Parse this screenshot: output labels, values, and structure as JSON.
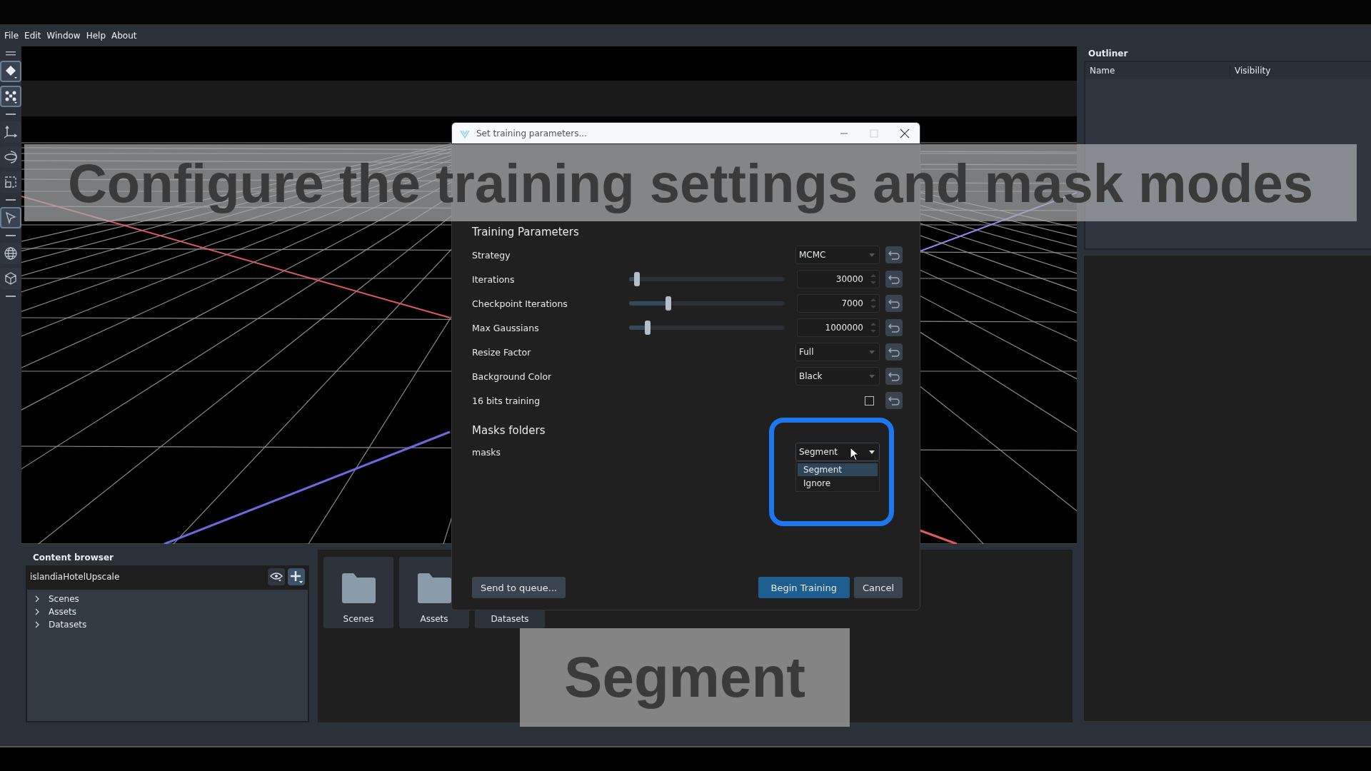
{
  "menu": [
    "File",
    "Edit",
    "Window",
    "Help",
    "About"
  ],
  "toolbar": [
    {
      "kind": "grip"
    },
    {
      "kind": "tool",
      "selected": true
    },
    {
      "kind": "tool",
      "selected": true
    },
    {
      "kind": "separator"
    },
    {
      "kind": "tool",
      "selected": false
    },
    {
      "kind": "tool",
      "selected": false
    },
    {
      "kind": "tool",
      "selected": false
    },
    {
      "kind": "separator"
    },
    {
      "kind": "tool",
      "selected": true
    },
    {
      "kind": "separator"
    },
    {
      "kind": "tool",
      "selected": false
    },
    {
      "kind": "tool",
      "selected": false
    },
    {
      "kind": "separator"
    }
  ],
  "outliner": {
    "title": "Outliner",
    "columns": [
      "Name",
      "Visibility"
    ]
  },
  "content_browser": {
    "title": "Content browser",
    "project": "islandiaHotelUpscale",
    "tree": [
      {
        "label": "Scenes",
        "expanded": false
      },
      {
        "label": "Assets",
        "expanded": false
      },
      {
        "label": "Datasets",
        "expanded": false
      }
    ],
    "tiles": [
      {
        "kind": "folder",
        "label": "Scenes"
      },
      {
        "kind": "folder",
        "label": "Assets"
      },
      {
        "kind": "covered",
        "label": "Datasets"
      }
    ]
  },
  "dialog": {
    "title": "Set training parameters...",
    "training": {
      "heading": "Training Parameters",
      "params": [
        {
          "kind": "dropdown",
          "label": "Strategy",
          "value": "MCMC"
        },
        {
          "kind": "slider",
          "label": "Iterations",
          "value": "30000",
          "level": 0.05
        },
        {
          "kind": "slider",
          "label": "Checkpoint Iterations",
          "value": "7000",
          "level": 0.25
        },
        {
          "kind": "slider",
          "label": "Max Gaussians",
          "value": "1000000",
          "level": 0.12
        },
        {
          "kind": "dropdown",
          "label": "Resize Factor",
          "value": "Full"
        },
        {
          "kind": "dropdown",
          "label": "Background Color",
          "value": "Black"
        },
        {
          "kind": "checkbox",
          "label": "16 bits training",
          "checked": false
        }
      ]
    },
    "masks": {
      "heading": "Masks folders",
      "folders": [
        {
          "name": "masks",
          "value": "Segment",
          "expanded": true,
          "options": [
            {
              "label": "Segment",
              "selected": true
            },
            {
              "label": "Ignore",
              "selected": false
            }
          ]
        }
      ]
    },
    "buttons": [
      {
        "label": "Send to queue...",
        "primary": false
      },
      {
        "label": "Begin Training",
        "primary": true
      },
      {
        "label": "Cancel",
        "primary": false
      }
    ]
  },
  "captions": {
    "top": "Configure the training settings and mask modes",
    "bottom": "Segment"
  }
}
